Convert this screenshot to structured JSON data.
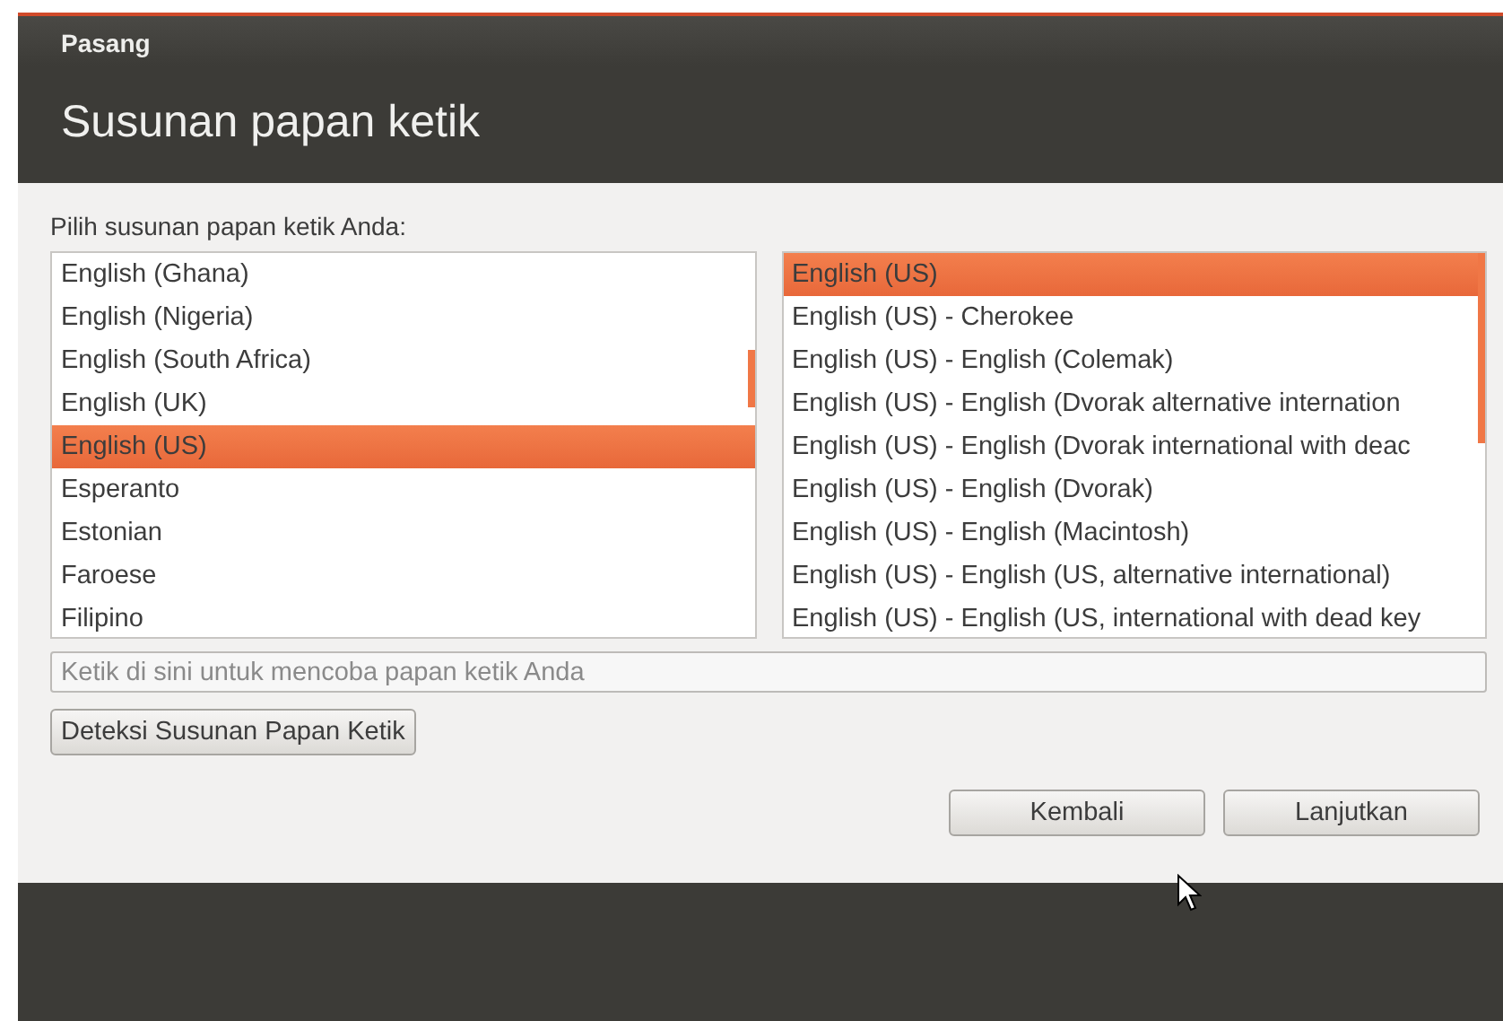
{
  "window": {
    "title": "Pasang"
  },
  "heading": "Susunan papan ketik",
  "prompt": "Pilih susunan papan ketik Anda:",
  "layouts": [
    {
      "label": "English (Ghana)",
      "selected": false
    },
    {
      "label": "English (Nigeria)",
      "selected": false
    },
    {
      "label": "English (South Africa)",
      "selected": false
    },
    {
      "label": "English (UK)",
      "selected": false
    },
    {
      "label": "English (US)",
      "selected": true
    },
    {
      "label": "Esperanto",
      "selected": false
    },
    {
      "label": "Estonian",
      "selected": false
    },
    {
      "label": "Faroese",
      "selected": false
    },
    {
      "label": "Filipino",
      "selected": false
    }
  ],
  "variants": [
    {
      "label": "English (US)",
      "selected": true
    },
    {
      "label": "English (US) - Cherokee",
      "selected": false
    },
    {
      "label": "English (US) - English (Colemak)",
      "selected": false
    },
    {
      "label": "English (US) - English (Dvorak alternative internation",
      "selected": false
    },
    {
      "label": "English (US) - English (Dvorak international with deac",
      "selected": false
    },
    {
      "label": "English (US) - English (Dvorak)",
      "selected": false
    },
    {
      "label": "English (US) - English (Macintosh)",
      "selected": false
    },
    {
      "label": "English (US) - English (US, alternative international)",
      "selected": false
    },
    {
      "label": "English (US) - English (US, international with dead key",
      "selected": false
    }
  ],
  "test_field": {
    "placeholder": "Ketik di sini untuk mencoba papan ketik Anda"
  },
  "detect_button": "Deteksi Susunan Papan Ketik",
  "buttons": [
    "Kembali",
    "Lanjutkan"
  ]
}
